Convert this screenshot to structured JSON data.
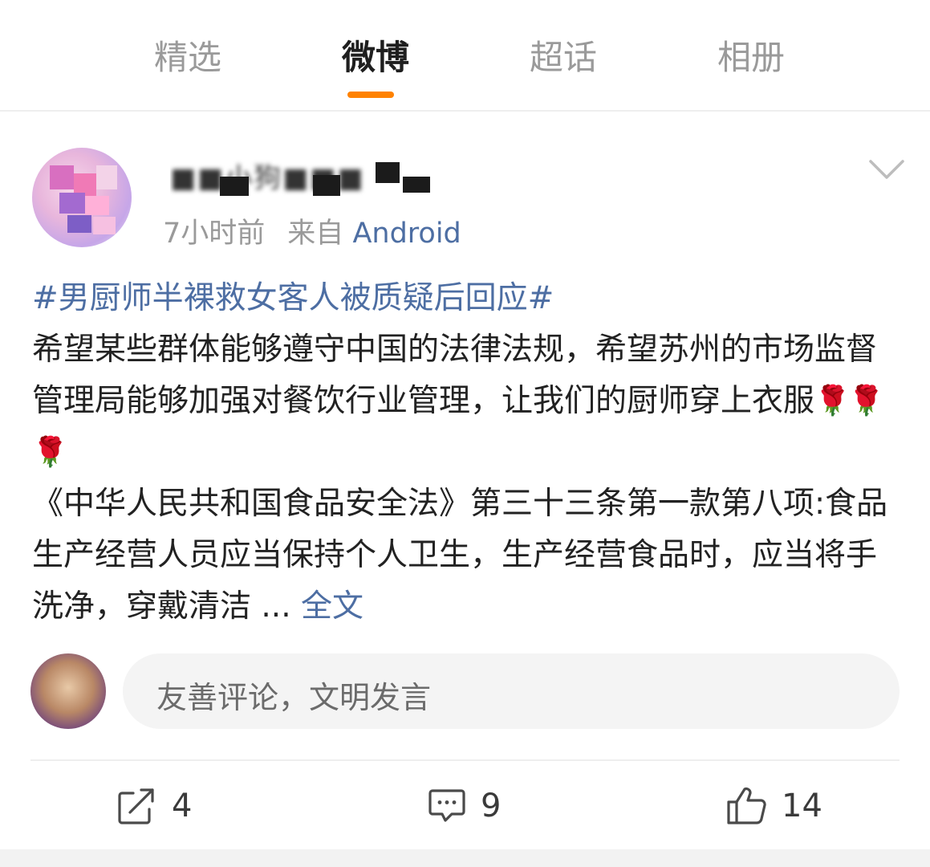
{
  "tabs": [
    {
      "label": "精选",
      "active": false
    },
    {
      "label": "微博",
      "active": true
    },
    {
      "label": "超话",
      "active": false
    },
    {
      "label": "相册",
      "active": false
    }
  ],
  "colors": {
    "accent": "#ff8200",
    "link": "#4d6ea3",
    "muted": "#9a9a9a",
    "text": "#222222"
  },
  "post": {
    "username_visible": "■■小狗■■■",
    "time": "7小时前",
    "source_prefix": "来自",
    "source": "Android",
    "topic": "#男厨师半裸救女客人被质疑后回应#",
    "text1": "希望某些群体能够遵守中国的法律法规，希望苏州的市场监督管理局能够加强对餐饮行业管理，让我们的厨师穿上衣服",
    "emoji_name": "rose-emoji",
    "emoji_glyph": "🌹",
    "text2": "《中华人民共和国食品安全法》第三十三条第一款第八项:食品生产经营人员应当保持个人卫生，生产经营食品时，应当将手洗净，穿戴清洁 ...",
    "more_label": "全文"
  },
  "comment_box": {
    "placeholder": "友善评论，文明发言"
  },
  "actions": {
    "repost_count": "4",
    "comment_count": "9",
    "like_count": "14"
  },
  "icons": [
    "chevron-down-icon",
    "repost-icon",
    "comment-icon",
    "like-icon"
  ]
}
